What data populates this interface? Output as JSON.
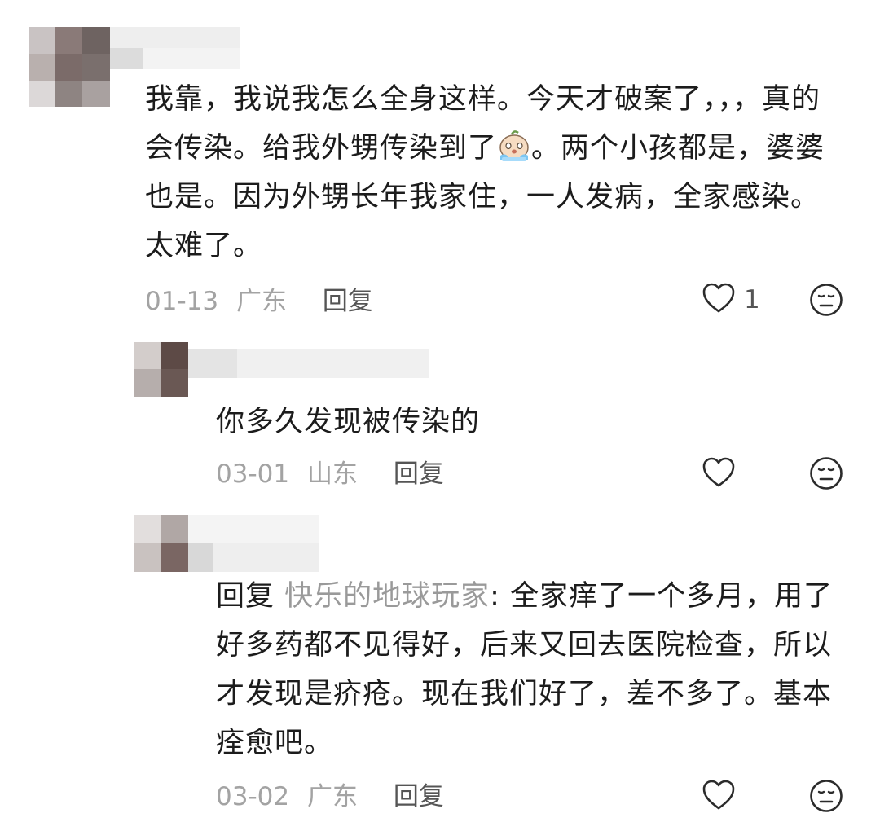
{
  "comments": [
    {
      "text": "我靠，我说我怎么全身这样。今天才破案了，，，真的会传染。给我外甥传染到了",
      "text_after_emoji": "。两个小孩都是，婆婆也是。因为外甥长年我家住，一人发病，全家感染。太难了。",
      "emoji": "crying-face-emoji",
      "date": "01-13",
      "location": "广东",
      "reply_label": "回复",
      "likes": "1"
    },
    {
      "text": "你多久发现被传染的",
      "date": "03-01",
      "location": "山东",
      "reply_label": "回复",
      "likes": ""
    },
    {
      "reply_prefix": "回复 ",
      "reply_target": "快乐的地球玩家",
      "reply_colon": ": ",
      "text": "全家痒了一个多月，用了好多药都不见得好，后来又回去医院检查，所以才发现是疥疮。现在我们好了，差不多了。基本痊愈吧。",
      "date": "03-02",
      "location": "广东",
      "reply_label": "回复",
      "likes": ""
    }
  ],
  "icons": {
    "like": "heart-outline-icon",
    "dislike": "meh-face-icon"
  },
  "colors": {
    "text": "#1c1c1c",
    "meta": "#a3a3a3",
    "reply_target": "#9a9a9a",
    "icon": "#2b2b2b"
  }
}
